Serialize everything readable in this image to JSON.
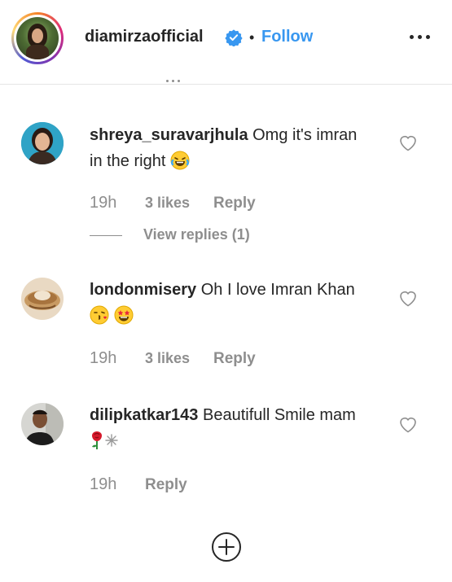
{
  "header": {
    "username": "diamirzaofficial",
    "separator": "•",
    "follow_label": "Follow",
    "more_icon": "more-horizontal-icon",
    "verified_icon": "verified-badge-icon",
    "accent_color": "#3897f0"
  },
  "comments": [
    {
      "username": "shreya_suravarjhula",
      "text": "Omg it's imran in the right",
      "emojis": [
        "face-with-tears-of-joy-emoji"
      ],
      "time": "19h",
      "likes": "3 likes",
      "reply_label": "Reply",
      "view_replies": "View replies (1)"
    },
    {
      "username": "londonmisery",
      "text": "Oh I love Imran Khan",
      "emojis": [
        "face-blowing-kiss-emoji",
        "star-struck-emoji"
      ],
      "time": "19h",
      "likes": "3 likes",
      "reply_label": "Reply"
    },
    {
      "username": "dilipkatkar143",
      "text": "Beautifull Smile mam",
      "emojis": [
        "rose-emoji",
        "sparkle-emoji"
      ],
      "time": "19h",
      "reply_label": "Reply"
    }
  ],
  "load_more_icon": "plus-circle-icon",
  "heart_icon": "heart-outline-icon"
}
